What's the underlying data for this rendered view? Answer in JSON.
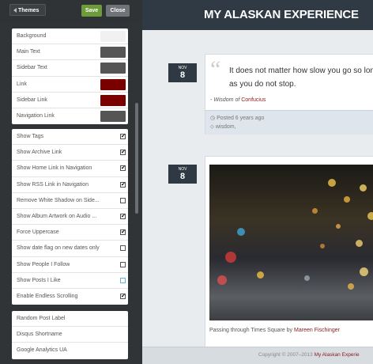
{
  "toolbar": {
    "themes_label": "Themes",
    "save_label": "Save",
    "close_label": "Close"
  },
  "colors": {
    "items": [
      {
        "label": "Background",
        "color": "#f1f1f1"
      },
      {
        "label": "Main Text",
        "color": "#555555"
      },
      {
        "label": "Sidebar Text",
        "color": "#555555"
      },
      {
        "label": "Link",
        "color": "#7a0000"
      },
      {
        "label": "Sidebar Link",
        "color": "#7a0000"
      },
      {
        "label": "Navigation Link",
        "color": "#555555"
      }
    ]
  },
  "options": {
    "items": [
      {
        "label": "Show Tags",
        "checked": true
      },
      {
        "label": "Show Archive Link",
        "checked": true
      },
      {
        "label": "Show Home Link in Navigation",
        "checked": true
      },
      {
        "label": "Show RSS Link in Navigation",
        "checked": true
      },
      {
        "label": "Remove White Shadow on Side...",
        "checked": false
      },
      {
        "label": "Show Album Artwork on Audio ...",
        "checked": true
      },
      {
        "label": "Force Uppercase",
        "checked": true
      },
      {
        "label": "Show date flag on new dates only",
        "checked": false
      },
      {
        "label": "Show People I Follow",
        "checked": false
      },
      {
        "label": "Show Posts I Like",
        "checked": false,
        "highlight": true
      },
      {
        "label": "Enable Endless Scrolling",
        "checked": true
      }
    ]
  },
  "text_fields": {
    "items": [
      {
        "label": "Random Post Label"
      },
      {
        "label": "Disqus Shortname"
      },
      {
        "label": "Google Analytics UA"
      }
    ]
  },
  "preview": {
    "site_title": "MY ALASKAN EXPERIENCE",
    "post1": {
      "month": "NOV",
      "day": "8",
      "quote_mark": "“",
      "quote": "It does not matter how slow you go so long as you do not stop.",
      "source_prefix": "- Wisdom of ",
      "source_link": "Confucius",
      "posted": "Posted 6 years ago",
      "tags": "wisdom,"
    },
    "post2": {
      "month": "NOV",
      "day": "8",
      "caption_prefix": "Passing through Times Square by ",
      "caption_link": "Mareen Fischinger"
    },
    "footer_prefix": "Copyright © 2007–2013 ",
    "footer_link": "My Alaskan Experie"
  }
}
